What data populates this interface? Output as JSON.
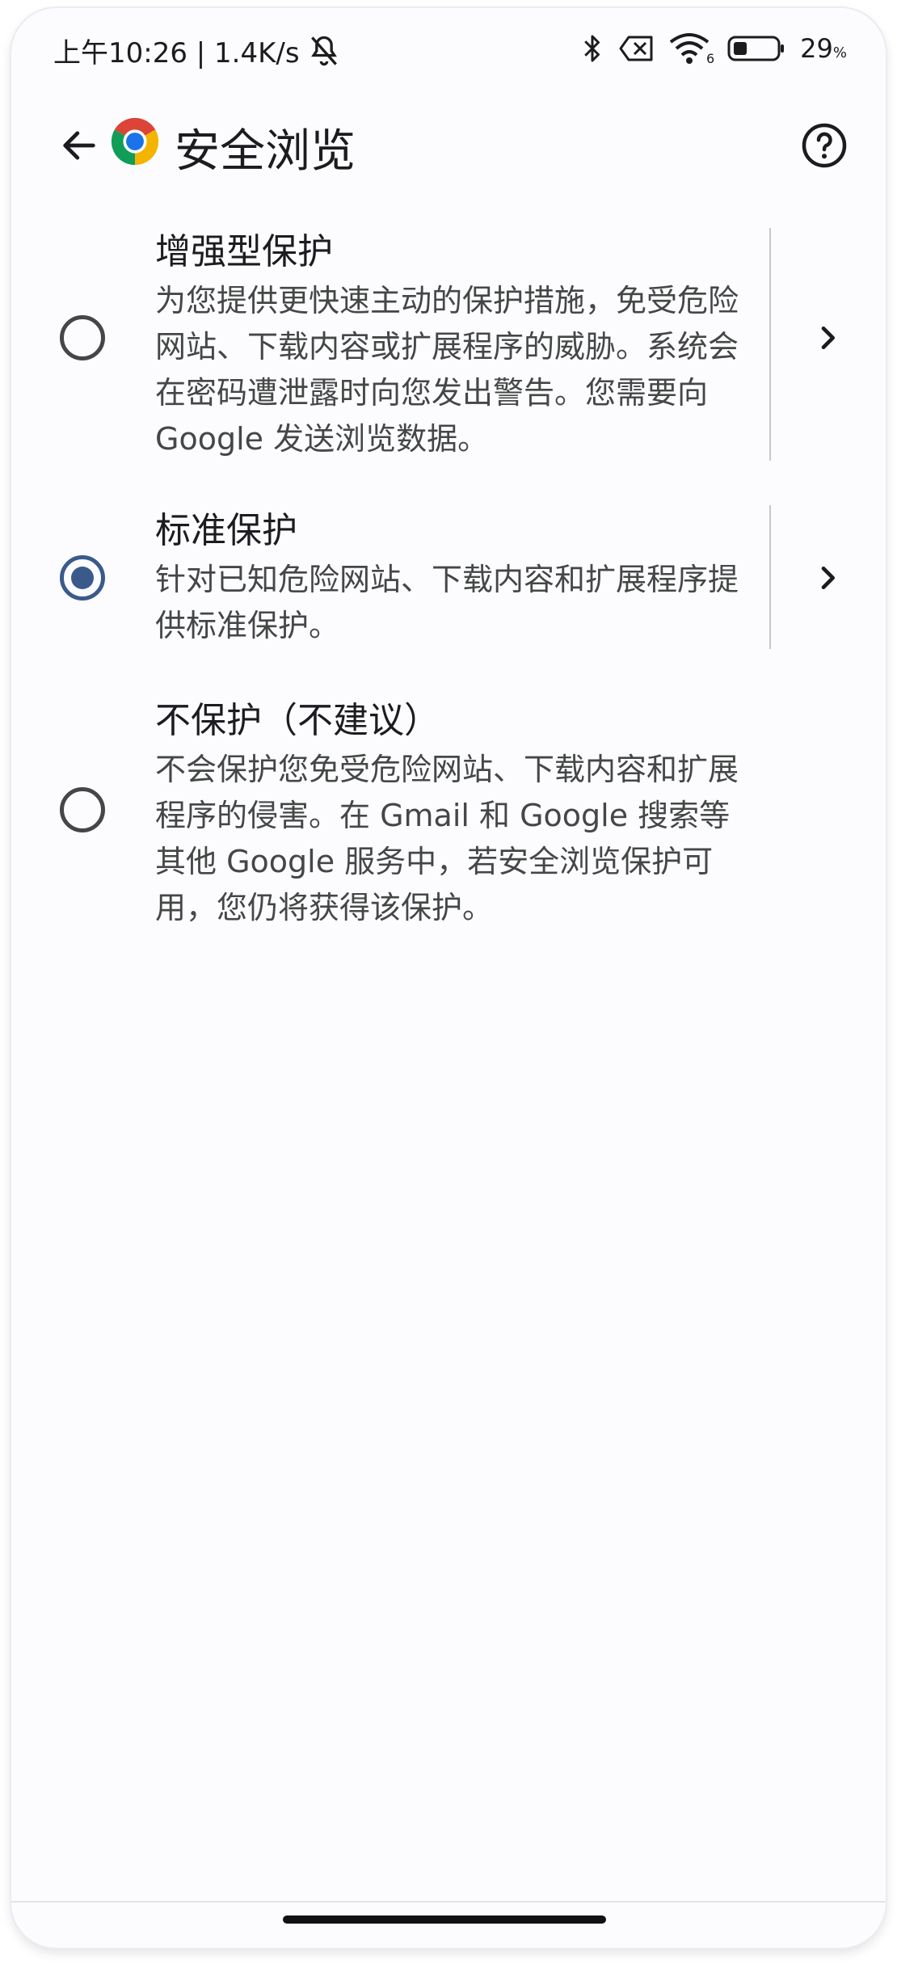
{
  "status_bar": {
    "time_speed": "上午10:26 | 1.4K/s",
    "battery_percent": "29",
    "battery_unit": "%",
    "wifi_badge": "6",
    "icons": [
      "mute-icon",
      "bluetooth-icon",
      "sim-off-icon",
      "wifi-icon",
      "battery-icon"
    ]
  },
  "app_bar": {
    "title": "安全浏览",
    "back_icon": "arrow-left-icon",
    "logo_icon": "chrome-logo-icon",
    "help_icon": "help-circle-icon"
  },
  "options": [
    {
      "title": "增强型保护",
      "description": "为您提供更快速主动的保护措施，免受危险网站、下载内容或扩展程序的威胁。系统会在密码遭泄露时向您发出警告。您需要向 Google 发送浏览数据。",
      "selected": false,
      "has_details": true
    },
    {
      "title": "标准保护",
      "description": "针对已知危险网站、下载内容和扩展程序提供标准保护。",
      "selected": true,
      "has_details": true
    },
    {
      "title": "不保护（不建议）",
      "description": "不会保护您免受危险网站、下载内容和扩展程序的侵害。在 Gmail 和 Google 搜索等其他 Google 服务中，若安全浏览保护可用，您仍将获得该保护。",
      "selected": false,
      "has_details": false
    }
  ],
  "colors": {
    "accent": "#3a5a8a",
    "background": "#fcfcff",
    "text_primary": "#1c1b1f",
    "text_secondary": "#444746"
  }
}
